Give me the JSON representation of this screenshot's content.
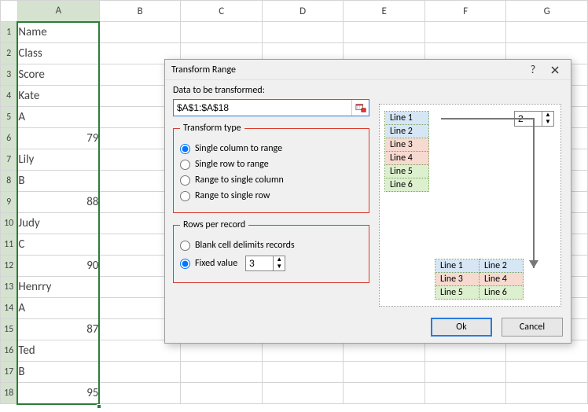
{
  "columns": [
    "A",
    "B",
    "C",
    "D",
    "E",
    "F",
    "G"
  ],
  "rowCount": 18,
  "selectedCol": "A",
  "cells": {
    "1": "Name",
    "2": "Class",
    "3": "Score",
    "4": "Kate",
    "5": "A",
    "6": "79",
    "7": "Lily",
    "8": "B",
    "9": "88",
    "10": "Judy",
    "11": "C",
    "12": "90",
    "13": "Henrry",
    "14": "A",
    "15": "87",
    "16": "Ted",
    "17": "B",
    "18": "95"
  },
  "numericRows": [
    6,
    9,
    12,
    15,
    18
  ],
  "dialog": {
    "title": "Transform Range",
    "label_data": "Data to be transformed:",
    "range_value": "$A$1:$A$18",
    "group_type": "Transform type",
    "opt_col2range": "Single column to range",
    "opt_row2range": "Single row to range",
    "opt_range2col": "Range to single column",
    "opt_range2row": "Range to single row",
    "type_selected": "col2range",
    "group_rows": "Rows per record",
    "opt_blank": "Blank cell delimits records",
    "opt_fixed": "Fixed value",
    "rows_selected": "fixed",
    "fixed_value": "3",
    "ok": "Ok",
    "cancel": "Cancel",
    "preview": {
      "count": "2",
      "top": [
        "Line 1",
        "Line 2",
        "Line 3",
        "Line 4",
        "Line 5",
        "Line 6"
      ],
      "bot": [
        [
          "Line 1",
          "Line 2"
        ],
        [
          "Line 3",
          "Line 4"
        ],
        [
          "Line 5",
          "Line 6"
        ]
      ]
    }
  }
}
